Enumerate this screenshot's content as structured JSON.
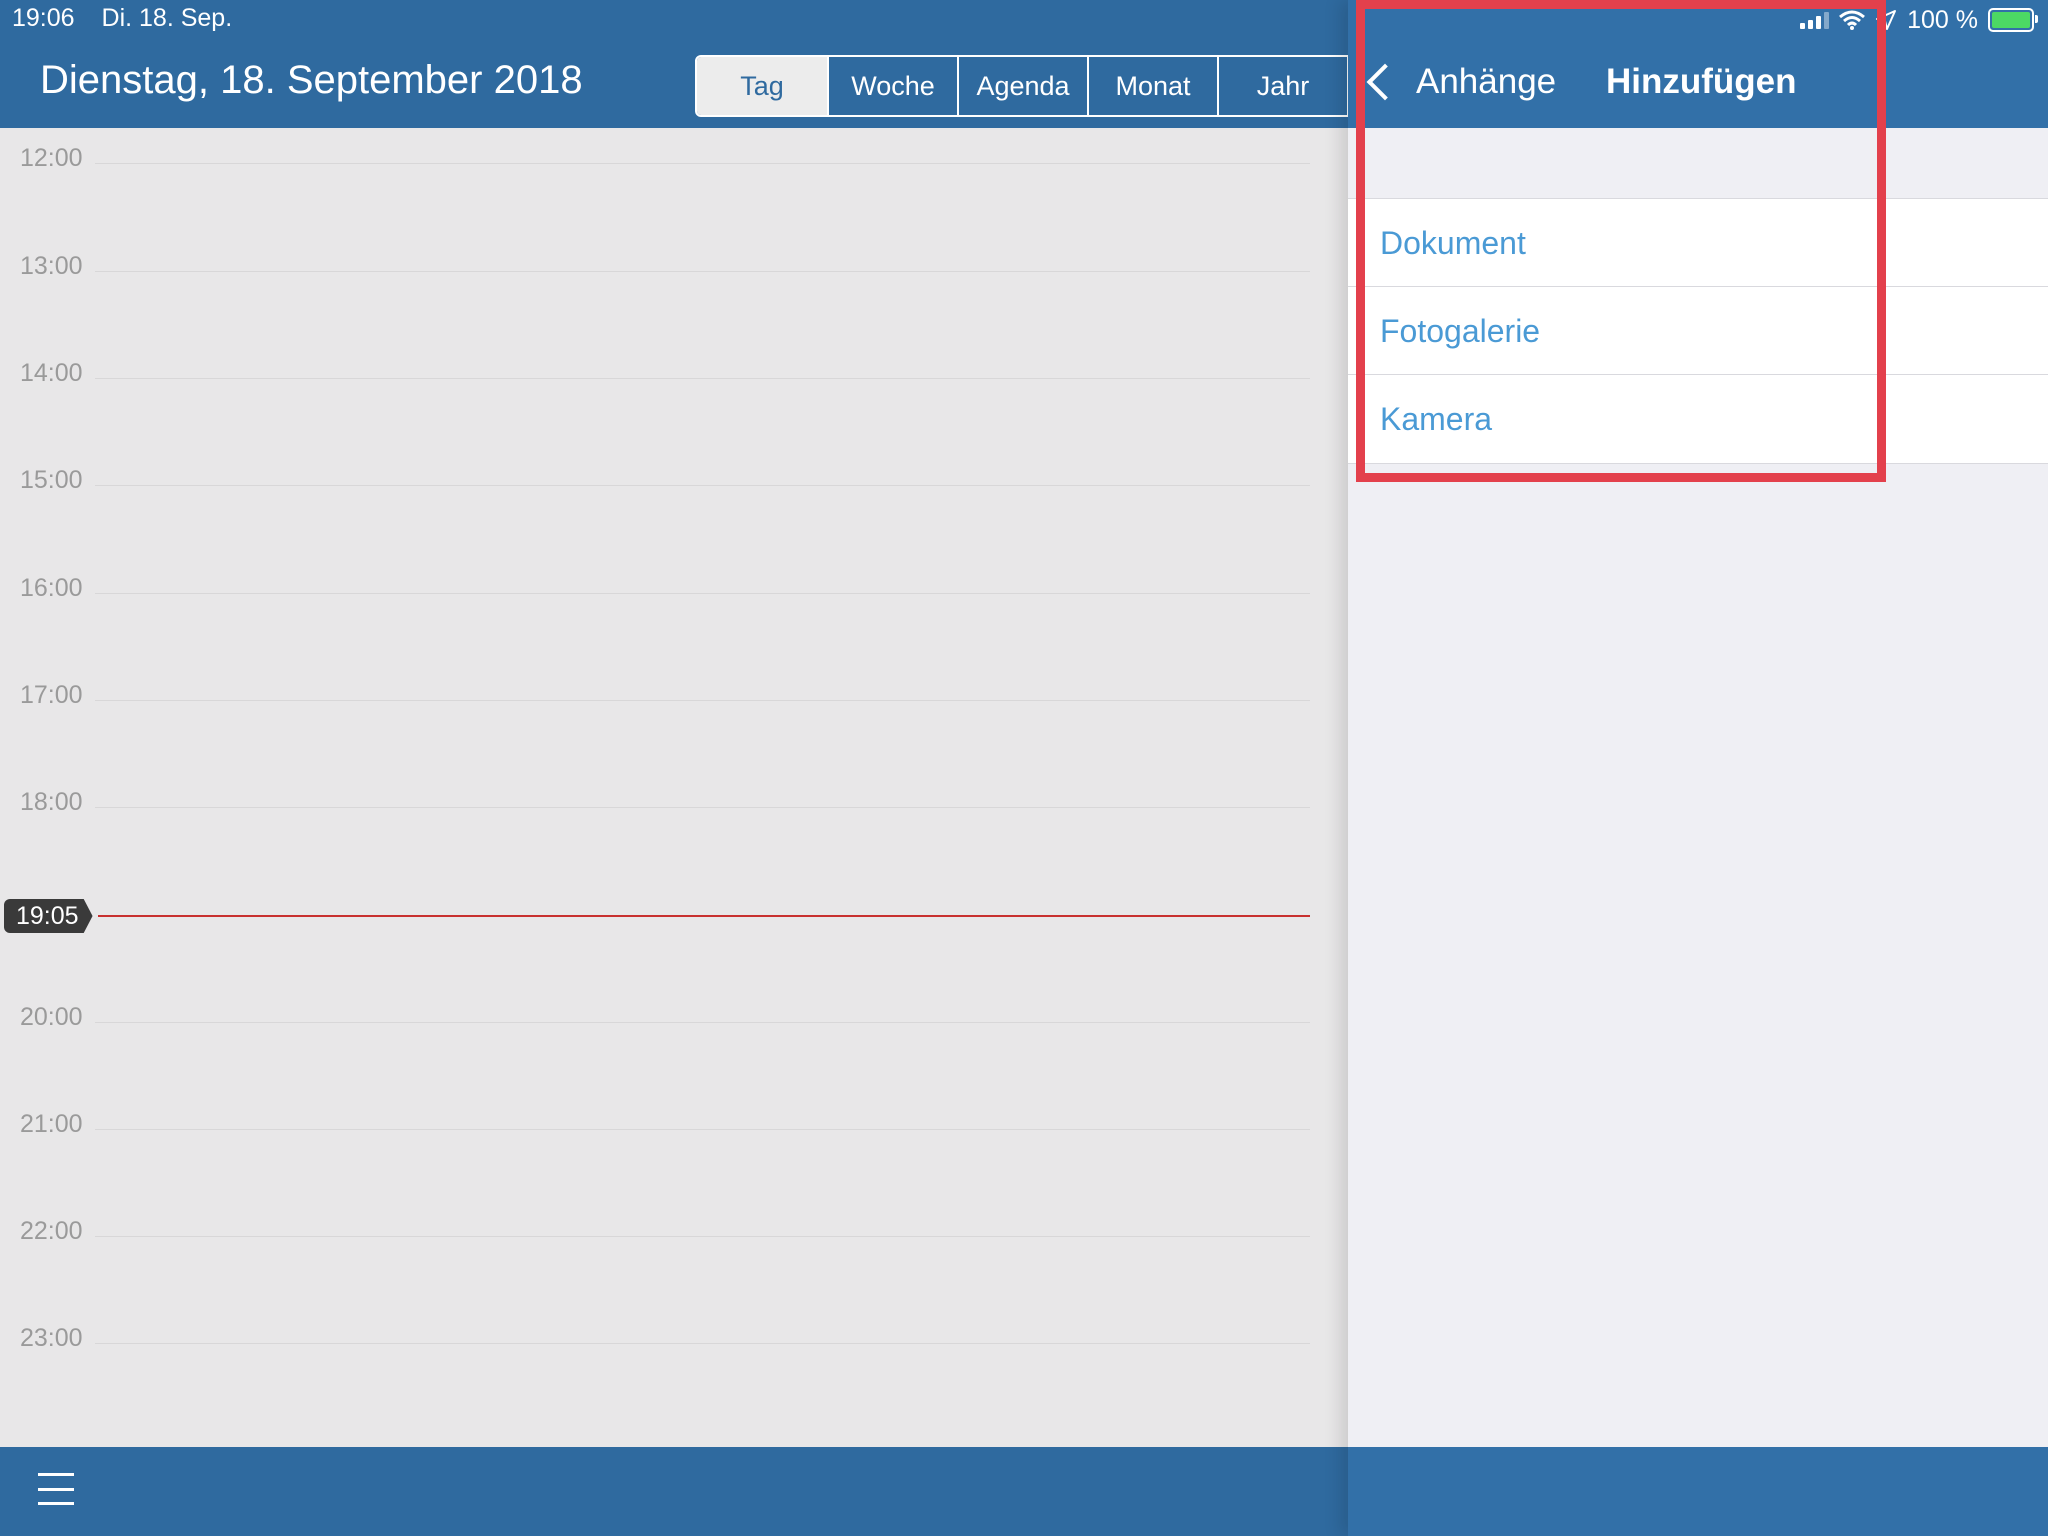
{
  "status_bar": {
    "time": "19:06",
    "date": "Di. 18. Sep.",
    "battery": "100 %",
    "icons": [
      "signal-icon",
      "wifi-icon",
      "location-icon",
      "battery-charging-icon"
    ]
  },
  "header": {
    "title": "Dienstag, 18. September 2018",
    "views": [
      "Tag",
      "Woche",
      "Agenda",
      "Monat",
      "Jahr"
    ],
    "active_view": "Tag"
  },
  "calendar": {
    "hours": [
      "12:00",
      "13:00",
      "14:00",
      "15:00",
      "16:00",
      "17:00",
      "18:00",
      "20:00",
      "21:00",
      "22:00",
      "23:00"
    ],
    "current_time": "19:05",
    "now_line_color": "#c8302f"
  },
  "toolbar": {
    "icons": [
      "menu-icon"
    ]
  },
  "panel": {
    "back_label": "Anhänge",
    "title": "Hinzufügen",
    "items": [
      "Dokument",
      "Fotogalerie",
      "Kamera"
    ]
  },
  "colors": {
    "brand_blue": "#2f6a9f",
    "link_blue": "#4a9ad5",
    "highlight_red": "#e3404c"
  }
}
